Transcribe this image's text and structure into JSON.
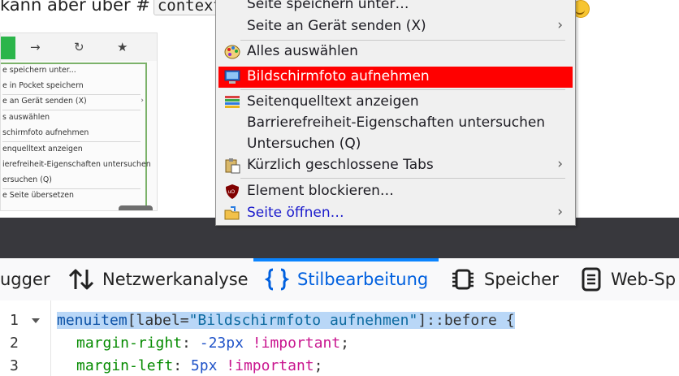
{
  "page": {
    "text_prefix": "kann aber über #",
    "inline_code": "context"
  },
  "thumbnail": {
    "items": [
      "e speichern unter...",
      "e in Pocket speichern",
      "e an Gerät senden (X)",
      "s auswählen",
      "schirmfoto aufnehmen",
      "enquelltext anzeigen",
      "ierefreiheit-Eigenschaften untersuchen",
      "ersuchen (Q)",
      "e Seite übersetzen"
    ]
  },
  "context_menu": {
    "items": [
      {
        "label": "Seite speichern unter…",
        "icon": "none"
      },
      {
        "label": "Seite an Gerät senden (X)",
        "submenu": "›"
      },
      {
        "label": "Alles auswählen",
        "icon": "palette-icon"
      },
      {
        "label": "Bildschirmfoto aufnehmen",
        "icon": "monitor-icon",
        "highlight": "#ff0000"
      },
      {
        "label": "Seitenquelltext anzeigen",
        "icon": "source-lines-icon"
      },
      {
        "label": "Barrierefreiheit-Eigenschaften untersuchen"
      },
      {
        "label": "Untersuchen (Q)"
      },
      {
        "label": "Kürzlich geschlossene Tabs",
        "icon": "clipboard-icon",
        "submenu": "›"
      },
      {
        "label": "Element blockieren…",
        "icon": "ublock-icon"
      },
      {
        "label": "Seite öffnen…",
        "icon": "folder-open-icon",
        "submenu": "›"
      }
    ]
  },
  "devtools": {
    "tabs": [
      {
        "label": "ugger"
      },
      {
        "label": "Netzwerkanalyse",
        "icon": "network-arrows-icon"
      },
      {
        "label": "Stilbearbeitung",
        "icon": "braces-icon",
        "selected": true
      },
      {
        "label": "Speicher",
        "icon": "memory-chip-icon"
      },
      {
        "label": "Web-Sp",
        "icon": "document-icon"
      }
    ],
    "accent": "#0a84ff"
  },
  "editor": {
    "lines": [
      {
        "num": "1",
        "selector": "menuitem",
        "attr_open": "[label=",
        "attr_value": "\"Bildschirmfoto aufnehmen\"",
        "attr_close": "]::before {"
      },
      {
        "num": "2",
        "prop": "margin-right",
        "value": "-23px",
        "important": "!important",
        "end": ";"
      },
      {
        "num": "3",
        "prop": "margin-left",
        "value": "5px",
        "important": "!important",
        "end": ";"
      }
    ]
  }
}
